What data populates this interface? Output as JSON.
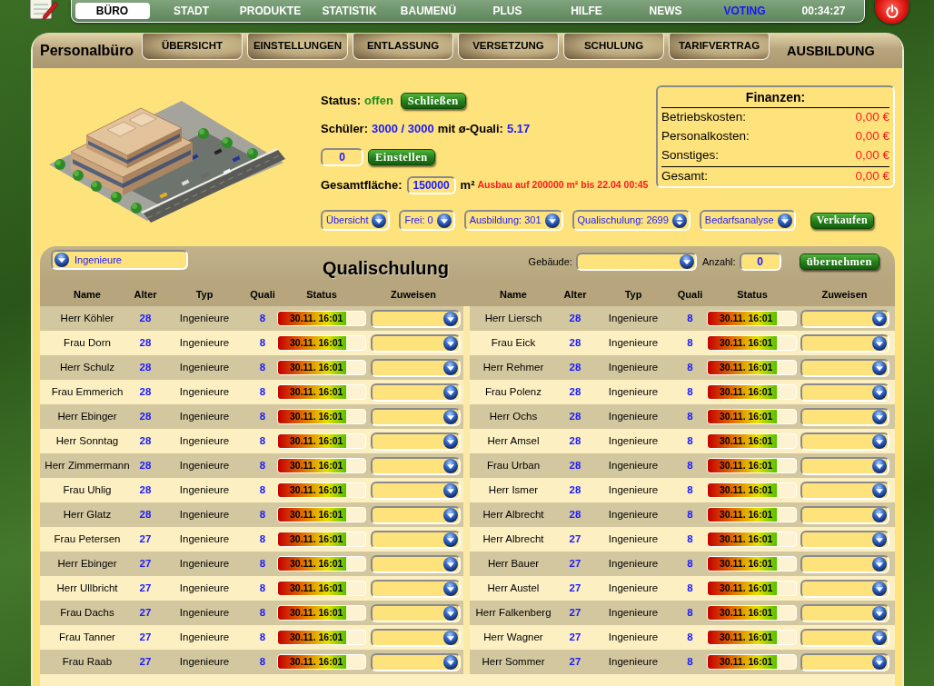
{
  "top_nav": {
    "items": [
      {
        "label": "BÜRO",
        "selected": true,
        "kind": "menu"
      },
      {
        "label": "STADT",
        "selected": false,
        "kind": "menu"
      },
      {
        "label": "PRODUKTE",
        "selected": false,
        "kind": "menu"
      },
      {
        "label": "STATISTIK",
        "selected": false,
        "kind": "menu"
      },
      {
        "label": "BAUMENÜ",
        "selected": false,
        "kind": "menu"
      },
      {
        "label": "PLUS",
        "selected": false,
        "kind": "menu"
      },
      {
        "label": "HILFE",
        "selected": false,
        "kind": "menu"
      },
      {
        "label": "NEWS",
        "selected": false,
        "kind": "menu"
      },
      {
        "label": "VOTING",
        "selected": false,
        "kind": "link"
      }
    ],
    "clock": "00:34:27"
  },
  "panel": {
    "title": "Personalbüro",
    "tabs": [
      {
        "label": "ÜBERSICHT",
        "selected": false
      },
      {
        "label": "EINSTELLUNGEN",
        "selected": false
      },
      {
        "label": "ENTLASSUNG",
        "selected": false
      },
      {
        "label": "VERSETZUNG",
        "selected": false
      },
      {
        "label": "SCHULUNG",
        "selected": false
      },
      {
        "label": "TARIFVERTRAG",
        "selected": false
      },
      {
        "label": "AUSBILDUNG",
        "selected": true
      }
    ]
  },
  "status": {
    "label": "Status:",
    "value": "offen",
    "button": "Schließen"
  },
  "students": {
    "label": "Schüler:",
    "value": "3000 / 3000",
    "quali_label": "mit ø-Quali:",
    "quali_value": "5.17"
  },
  "hire": {
    "value": "0",
    "button": "Einstellen"
  },
  "area": {
    "label": "Gesamtfläche:",
    "value": "150000",
    "unit": "m²",
    "notice": "Ausbau auf 200000 m² bis 22.04 00:45"
  },
  "finances": {
    "title": "Finanzen:",
    "rows": [
      {
        "label": "Betriebskosten:",
        "value": "0,00 €",
        "kind": "item"
      },
      {
        "label": "Personalkosten:",
        "value": "0,00 €",
        "kind": "item"
      },
      {
        "label": "Sonstiges:",
        "value": "0,00 €",
        "kind": "item"
      },
      {
        "label": "Gesamt:",
        "value": "0,00 €",
        "kind": "total"
      }
    ]
  },
  "views": [
    {
      "label": "Übersicht",
      "expanded": false
    },
    {
      "label": "Frei: 0",
      "expanded": false
    },
    {
      "label": "Ausbildung: 301",
      "expanded": false
    },
    {
      "label": "Qualischulung: 2699",
      "expanded": true
    },
    {
      "label": "Bedarfsanalyse",
      "expanded": false
    }
  ],
  "sell_button": "Verkaufen",
  "qualischulung": {
    "filter": "Ingenieure",
    "title": "Qualischulung",
    "building_label": "Gebäude:",
    "count_label": "Anzahl:",
    "count_value": "0",
    "apply_button": "übernehmen",
    "tables": [
      {
        "columns": [
          "Name",
          "Alter",
          "Typ",
          "Quali",
          "Status",
          "Zuweisen"
        ],
        "rows": [
          {
            "name": "Herr Köhler",
            "age": "28",
            "type": "Ingenieure",
            "quali": "8",
            "status": {
              "text": "30.11. 16:01",
              "level": 0.78
            }
          },
          {
            "name": "Frau Dorn",
            "age": "28",
            "type": "Ingenieure",
            "quali": "8",
            "status": {
              "text": "30.11. 16:01",
              "level": 0.78
            }
          },
          {
            "name": "Herr Schulz",
            "age": "28",
            "type": "Ingenieure",
            "quali": "8",
            "status": {
              "text": "30.11. 16:01",
              "level": 0.78
            }
          },
          {
            "name": "Frau Emmerich",
            "age": "28",
            "type": "Ingenieure",
            "quali": "8",
            "status": {
              "text": "30.11. 16:01",
              "level": 0.78
            }
          },
          {
            "name": "Herr Ebinger",
            "age": "28",
            "type": "Ingenieure",
            "quali": "8",
            "status": {
              "text": "30.11. 16:01",
              "level": 0.78
            }
          },
          {
            "name": "Herr Sonntag",
            "age": "28",
            "type": "Ingenieure",
            "quali": "8",
            "status": {
              "text": "30.11. 16:01",
              "level": 0.78
            }
          },
          {
            "name": "Herr Zimmermann",
            "age": "28",
            "type": "Ingenieure",
            "quali": "8",
            "status": {
              "text": "30.11. 16:01",
              "level": 0.78
            }
          },
          {
            "name": "Frau Uhlig",
            "age": "28",
            "type": "Ingenieure",
            "quali": "8",
            "status": {
              "text": "30.11. 16:01",
              "level": 0.78
            }
          },
          {
            "name": "Herr Glatz",
            "age": "28",
            "type": "Ingenieure",
            "quali": "8",
            "status": {
              "text": "30.11. 16:01",
              "level": 0.78
            }
          },
          {
            "name": "Frau Petersen",
            "age": "27",
            "type": "Ingenieure",
            "quali": "8",
            "status": {
              "text": "30.11. 16:01",
              "level": 0.78
            }
          },
          {
            "name": "Herr Ebinger",
            "age": "27",
            "type": "Ingenieure",
            "quali": "8",
            "status": {
              "text": "30.11. 16:01",
              "level": 0.78
            }
          },
          {
            "name": "Herr Ullbricht",
            "age": "27",
            "type": "Ingenieure",
            "quali": "8",
            "status": {
              "text": "30.11. 16:01",
              "level": 0.78
            }
          },
          {
            "name": "Frau Dachs",
            "age": "27",
            "type": "Ingenieure",
            "quali": "8",
            "status": {
              "text": "30.11. 16:01",
              "level": 0.78
            }
          },
          {
            "name": "Frau Tanner",
            "age": "27",
            "type": "Ingenieure",
            "quali": "8",
            "status": {
              "text": "30.11. 16:01",
              "level": 0.78
            }
          },
          {
            "name": "Frau Raab",
            "age": "27",
            "type": "Ingenieure",
            "quali": "8",
            "status": {
              "text": "30.11. 16:01",
              "level": 0.78
            }
          }
        ]
      },
      {
        "columns": [
          "Name",
          "Alter",
          "Typ",
          "Quali",
          "Status",
          "Zuweisen"
        ],
        "rows": [
          {
            "name": "Herr Liersch",
            "age": "28",
            "type": "Ingenieure",
            "quali": "8",
            "status": {
              "text": "30.11. 16:01",
              "level": 0.78
            }
          },
          {
            "name": "Frau Eick",
            "age": "28",
            "type": "Ingenieure",
            "quali": "8",
            "status": {
              "text": "30.11. 16:01",
              "level": 0.78
            }
          },
          {
            "name": "Herr Rehmer",
            "age": "28",
            "type": "Ingenieure",
            "quali": "8",
            "status": {
              "text": "30.11. 16:01",
              "level": 0.78
            }
          },
          {
            "name": "Frau Polenz",
            "age": "28",
            "type": "Ingenieure",
            "quali": "8",
            "status": {
              "text": "30.11. 16:01",
              "level": 0.78
            }
          },
          {
            "name": "Herr Ochs",
            "age": "28",
            "type": "Ingenieure",
            "quali": "8",
            "status": {
              "text": "30.11. 16:01",
              "level": 0.78
            }
          },
          {
            "name": "Herr Amsel",
            "age": "28",
            "type": "Ingenieure",
            "quali": "8",
            "status": {
              "text": "30.11. 16:01",
              "level": 0.78
            }
          },
          {
            "name": "Frau Urban",
            "age": "28",
            "type": "Ingenieure",
            "quali": "8",
            "status": {
              "text": "30.11. 16:01",
              "level": 0.78
            }
          },
          {
            "name": "Herr Ismer",
            "age": "28",
            "type": "Ingenieure",
            "quali": "8",
            "status": {
              "text": "30.11. 16:01",
              "level": 0.78
            }
          },
          {
            "name": "Herr Albrecht",
            "age": "28",
            "type": "Ingenieure",
            "quali": "8",
            "status": {
              "text": "30.11. 16:01",
              "level": 0.78
            }
          },
          {
            "name": "Herr Albrecht",
            "age": "27",
            "type": "Ingenieure",
            "quali": "8",
            "status": {
              "text": "30.11. 16:01",
              "level": 0.78
            }
          },
          {
            "name": "Herr Bauer",
            "age": "27",
            "type": "Ingenieure",
            "quali": "8",
            "status": {
              "text": "30.11. 16:01",
              "level": 0.78
            }
          },
          {
            "name": "Herr Austel",
            "age": "27",
            "type": "Ingenieure",
            "quali": "8",
            "status": {
              "text": "30.11. 16:01",
              "level": 0.78
            }
          },
          {
            "name": "Herr Falkenberg",
            "age": "27",
            "type": "Ingenieure",
            "quali": "8",
            "status": {
              "text": "30.11. 16:01",
              "level": 0.78
            }
          },
          {
            "name": "Herr Wagner",
            "age": "27",
            "type": "Ingenieure",
            "quali": "8",
            "status": {
              "text": "30.11. 16:01",
              "level": 0.78
            }
          },
          {
            "name": "Herr Sommer",
            "age": "27",
            "type": "Ingenieure",
            "quali": "8",
            "status": {
              "text": "30.11. 16:01",
              "level": 0.78
            }
          }
        ]
      }
    ]
  }
}
